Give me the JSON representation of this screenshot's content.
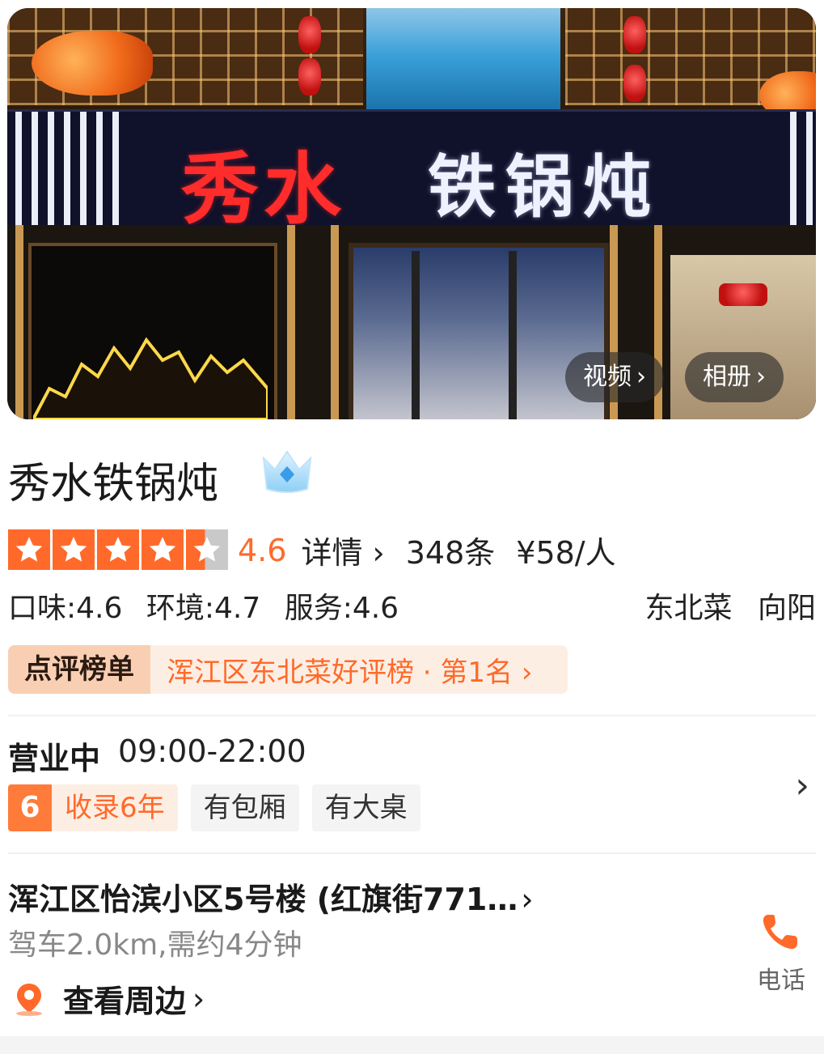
{
  "hero": {
    "sign_red": "秀水",
    "sign_white": "铁锅炖",
    "video_label": "视频",
    "album_label": "相册"
  },
  "shop": {
    "name": "秀水铁锅炖",
    "rating": "4.6",
    "rating_value": 4.6,
    "details_label": "详情",
    "review_count": "348条",
    "avg_price": "¥58/人",
    "taste": "口味:4.6",
    "environment": "环境:4.7",
    "service": "服务:4.6",
    "cuisine": "东北菜",
    "area": "向阳"
  },
  "ranking": {
    "tag": "点评榜单",
    "text": "浑江区东北菜好评榜 · 第1名"
  },
  "hours": {
    "status": "营业中",
    "time": "09:00-22:00"
  },
  "tags": {
    "years_num": "6",
    "years_text": "收录6年",
    "private_room": "有包厢",
    "big_table": "有大桌"
  },
  "location": {
    "address": "浑江区怡滨小区5号楼 (红旗街771…",
    "drive": "驾车2.0km,需约4分钟",
    "nearby": "查看周边",
    "phone_label": "电话"
  },
  "colors": {
    "accent": "#ff6a2a",
    "star_empty": "#c9c9c9",
    "rank_bg": "#fdeee4"
  }
}
